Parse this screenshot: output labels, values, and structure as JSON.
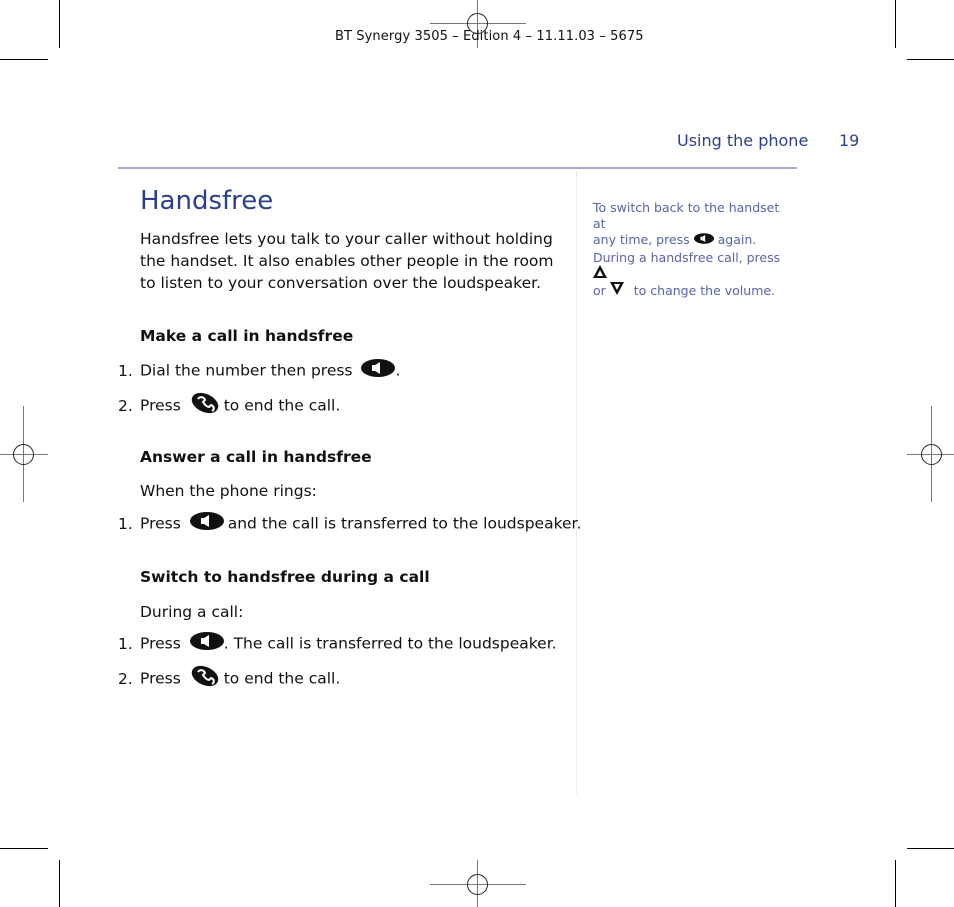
{
  "print_marks": {
    "slug": "BT Synergy 3505 – Edition 4 – 11.11.03 – 5675"
  },
  "header": {
    "section": "Using the phone",
    "page_number": "19"
  },
  "main": {
    "title": "Handsfree",
    "intro": "Handsfree lets you talk to your caller without holding the handset. It also enables other people in the room to listen to your conversation over the loudspeaker.",
    "sections": [
      {
        "heading": "Make a call in handsfree",
        "steps": [
          {
            "num": "1.",
            "before": "Dial the number then press",
            "icon": "handsfree-key-icon",
            "after": "."
          },
          {
            "num": "2.",
            "before": "Press",
            "icon": "end-call-key-icon",
            "after": "to end the call."
          }
        ]
      },
      {
        "heading": "Answer a call in handsfree",
        "lead": "When the phone rings:",
        "steps": [
          {
            "num": "1.",
            "before": "Press",
            "icon": "handsfree-key-icon",
            "after": "and the call is transferred to the loudspeaker."
          }
        ]
      },
      {
        "heading": "Switch to handsfree during a call",
        "lead": "During a call:",
        "steps": [
          {
            "num": "1.",
            "before": "Press",
            "icon": "handsfree-key-icon",
            "after": ". The call is transferred to the loudspeaker."
          },
          {
            "num": "2.",
            "before": "Press",
            "icon": "end-call-key-icon",
            "after": "to end the call."
          }
        ]
      }
    ]
  },
  "sidebar": {
    "tip1": {
      "line1": "To switch back to the handset at",
      "line2_before": "any time, press",
      "icon": "handsfree-key-icon",
      "line2_after": "again."
    },
    "tip2": {
      "line1_before": "During a handsfree call, press",
      "icon_up": "volume-up-icon",
      "line2_or": "or",
      "icon_down": "volume-down-icon",
      "line2_after": "to change the volume."
    }
  },
  "colors": {
    "accent": "#2c3f8c",
    "sidebar_text": "#5a64a8",
    "rule": "#a8a9cc"
  }
}
